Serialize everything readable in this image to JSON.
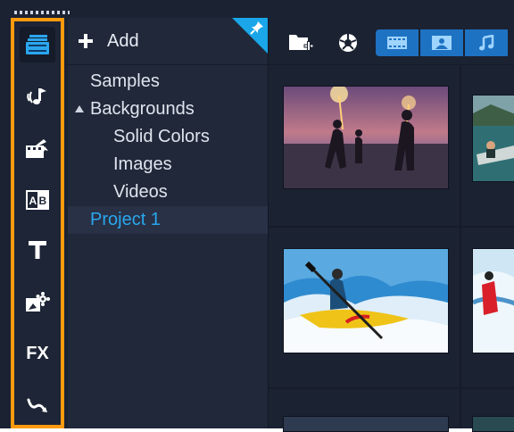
{
  "library_panel": {
    "add_label": "Add",
    "tree": [
      {
        "label": "Samples",
        "level": 0
      },
      {
        "label": "Backgrounds",
        "level": 0,
        "expanded": true
      },
      {
        "label": "Solid Colors",
        "level": 1
      },
      {
        "label": "Images",
        "level": 1
      },
      {
        "label": "Videos",
        "level": 1
      },
      {
        "label": "Project 1",
        "level": 0,
        "selected": true
      }
    ]
  },
  "rail": {
    "items": [
      {
        "icon": "media-library-icon",
        "active": true
      },
      {
        "icon": "audio-icon"
      },
      {
        "icon": "instant-project-icon"
      },
      {
        "icon": "transition-icon"
      },
      {
        "icon": "title-icon"
      },
      {
        "icon": "graphics-icon"
      },
      {
        "icon": "filter-fx-icon"
      },
      {
        "icon": "path-icon"
      }
    ],
    "fx_label": "FX",
    "title_glyph": "T",
    "transition_glyph": "AB"
  },
  "toolbar": {
    "buttons": [
      "import-folder-icon",
      "capture-icon"
    ],
    "media_filters": [
      "video-filter-icon",
      "photo-filter-icon",
      "audio-filter-icon"
    ]
  },
  "thumbnails": [
    {
      "name": "beach-sparklers-thumbnail"
    },
    {
      "name": "lake-boat-thumbnail"
    },
    {
      "name": "kayak-rapids-thumbnail"
    },
    {
      "name": "whitewater-thumbnail"
    }
  ],
  "colors": {
    "highlight_border": "#ff9a0e",
    "accent_blue": "#1e72c2",
    "selected_text": "#2aa7ef",
    "pin_corner": "#1aa6e8"
  }
}
